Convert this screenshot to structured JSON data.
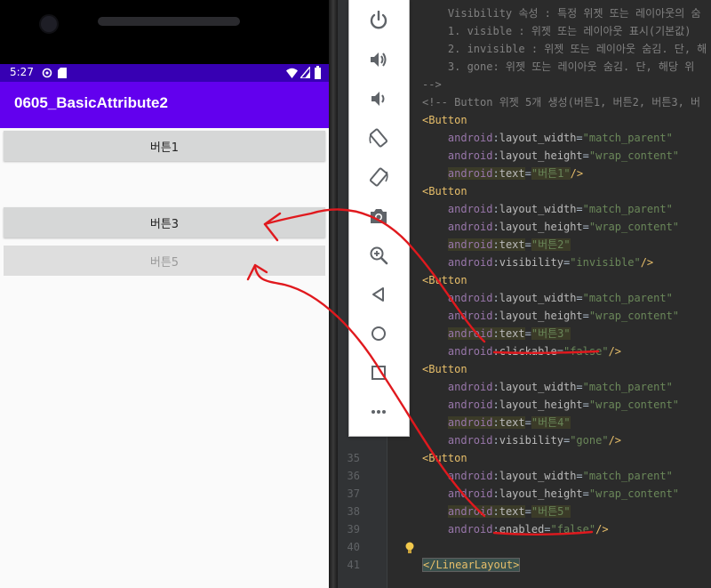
{
  "phone": {
    "status_time": "5:27",
    "app_title": "0605_BasicAttribute2",
    "buttons": [
      {
        "label": "버튼1",
        "enabled": true
      },
      {
        "label": "버튼3",
        "enabled": true
      },
      {
        "label": "버튼5",
        "enabled": false
      }
    ]
  },
  "toolbar": {
    "icons": [
      "power-icon",
      "volume-up-icon",
      "volume-down-icon",
      "rotate-left-icon",
      "rotate-right-icon",
      "camera-icon",
      "zoom-icon",
      "back-icon",
      "home-icon",
      "overview-icon",
      "more-icon"
    ]
  },
  "editor": {
    "lines": [
      {
        "no": "",
        "text": "    Visibility 속성 : 특정 위젯 또는 레이아웃의 숨"
      },
      {
        "no": "",
        "text": "    1. visible : 위젯 또는 레이아웃 표시(기본값)"
      },
      {
        "no": "",
        "text": "    2. invisible : 위젯 또는 레이아웃 숨김. 단, 해"
      },
      {
        "no": "",
        "text": "    3. gone: 위젯 또는 레이아웃 숨김. 단, 해당 위"
      },
      {
        "no": "",
        "text": "-->"
      },
      {
        "no": "",
        "text": "<!-- Button 위젯 5개 생성(버튼1, 버튼2, 버튼3, 버"
      },
      {
        "no": "",
        "text": "<Button"
      },
      {
        "no": "",
        "text": "    android:layout_width=\"match_parent\""
      },
      {
        "no": "",
        "text": "    android:layout_height=\"wrap_content\""
      },
      {
        "no": "",
        "text": "    android:text=\"버튼1\"/>"
      },
      {
        "no": "",
        "text": "<Button"
      },
      {
        "no": "",
        "text": "    android:layout_width=\"match_parent\""
      },
      {
        "no": "",
        "text": "    android:layout_height=\"wrap_content\""
      },
      {
        "no": "",
        "text": "    android:text=\"버튼2\""
      },
      {
        "no": "",
        "text": "    android:visibility=\"invisible\"/>"
      },
      {
        "no": "",
        "text": "<Button"
      },
      {
        "no": "",
        "text": "    android:layout_width=\"match_parent\""
      },
      {
        "no": "",
        "text": "    android:layout_height=\"wrap_content\""
      },
      {
        "no": "",
        "text": "    android:text=\"버튼3\""
      },
      {
        "no": "",
        "text": "    android:clickable=\"false\"/>"
      },
      {
        "no": "",
        "text": "<Button"
      },
      {
        "no": "",
        "text": "    android:layout_width=\"match_parent\""
      },
      {
        "no": "",
        "text": "    android:layout_height=\"wrap_content\""
      },
      {
        "no": "",
        "text": "    android:text=\"버튼4\""
      },
      {
        "no": "",
        "text": "    android:visibility=\"gone\"/>"
      },
      {
        "no": "35",
        "text": "<Button"
      },
      {
        "no": "36",
        "text": "    android:layout_width=\"match_parent\""
      },
      {
        "no": "37",
        "text": "    android:layout_height=\"wrap_content\""
      },
      {
        "no": "38",
        "text": "    android:text=\"버튼5\""
      },
      {
        "no": "39",
        "text": "    android:enabled=\"false\"/>"
      },
      {
        "no": "40",
        "text": ""
      },
      {
        "no": "41",
        "text": "</LinearLayout>"
      }
    ]
  },
  "colors": {
    "app_bar": "#6200ee",
    "status_bar": "#3700b3",
    "annotation": "#e0191e"
  }
}
